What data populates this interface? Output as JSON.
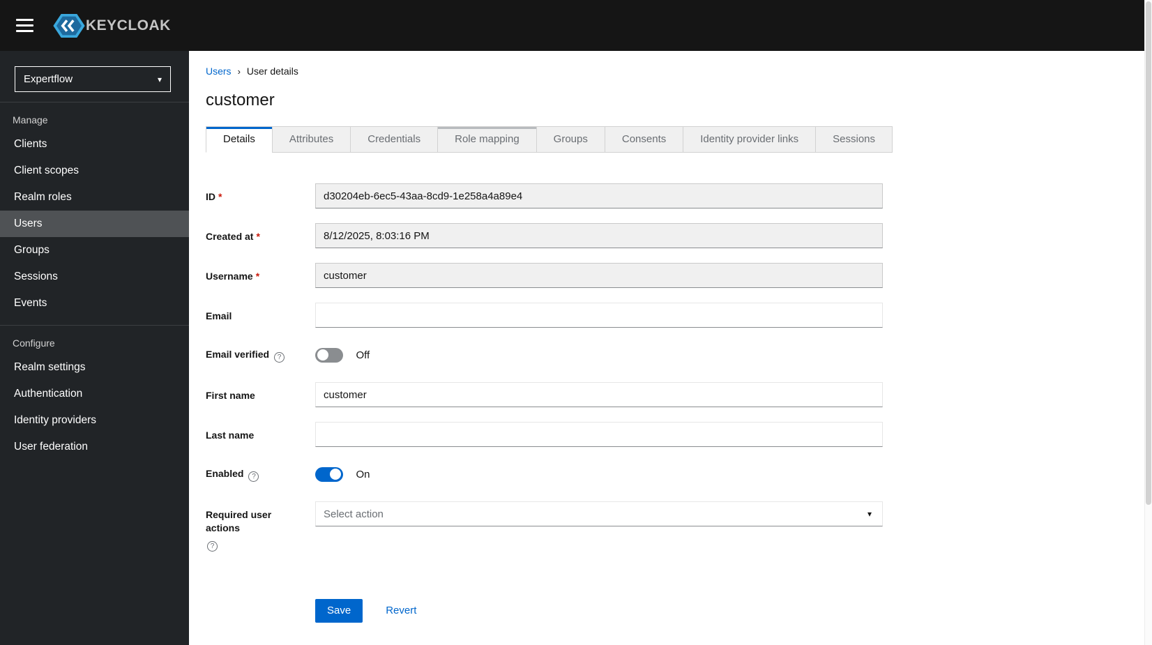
{
  "topbar": {
    "brand": "KEYCLOAK"
  },
  "sidebar": {
    "realm": "Expertflow",
    "manage_label": "Manage",
    "manage_items": [
      "Clients",
      "Client scopes",
      "Realm roles",
      "Users",
      "Groups",
      "Sessions",
      "Events"
    ],
    "configure_label": "Configure",
    "configure_items": [
      "Realm settings",
      "Authentication",
      "Identity providers",
      "User federation"
    ]
  },
  "breadcrumb": {
    "parent": "Users",
    "separator": "›",
    "current": "User details"
  },
  "page": {
    "title": "customer"
  },
  "tabs": [
    "Details",
    "Attributes",
    "Credentials",
    "Role mapping",
    "Groups",
    "Consents",
    "Identity provider links",
    "Sessions"
  ],
  "misc": {
    "required_marker": "*",
    "help_glyph": "?",
    "caret": "▾"
  },
  "form": {
    "id": {
      "label": "ID",
      "value": "d30204eb-6ec5-43aa-8cd9-1e258a4a89e4"
    },
    "created_at": {
      "label": "Created at",
      "value": "8/12/2025, 8:03:16 PM"
    },
    "username": {
      "label": "Username",
      "value": "customer"
    },
    "email": {
      "label": "Email",
      "value": ""
    },
    "email_verified": {
      "label": "Email verified",
      "state": "Off"
    },
    "first_name": {
      "label": "First name",
      "value": "customer"
    },
    "last_name": {
      "label": "Last name",
      "value": ""
    },
    "enabled": {
      "label": "Enabled",
      "state": "On"
    },
    "required_user_actions": {
      "label": "Required user actions",
      "placeholder": "Select action"
    }
  },
  "actions": {
    "save": "Save",
    "revert": "Revert"
  }
}
